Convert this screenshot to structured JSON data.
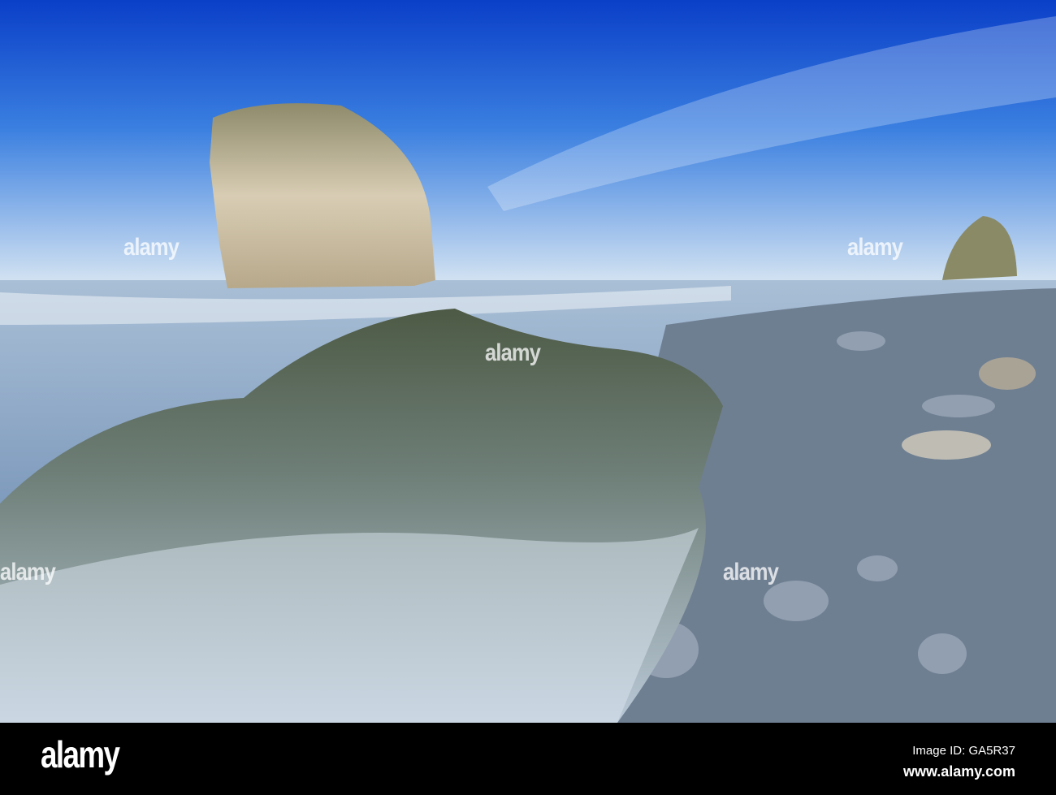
{
  "watermark": {
    "text": "alamy"
  },
  "footer": {
    "logo": "alamy",
    "image_id": "Image ID: GA5R37",
    "url": "www.alamy.com"
  },
  "colors": {
    "sky_top": "#0a3fc8",
    "sky_horizon": "#cfe0f0",
    "sea": "#8fa9c4",
    "rock": "#c9b89a"
  }
}
